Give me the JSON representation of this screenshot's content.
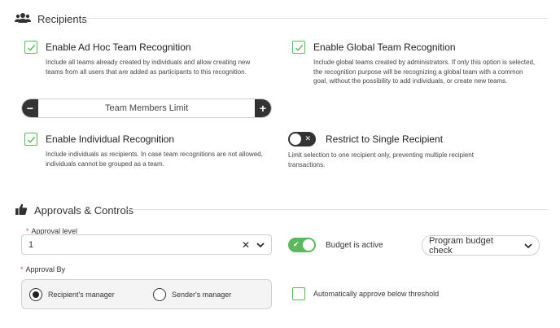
{
  "recipients": {
    "header": "Recipients",
    "icon": "users-icon",
    "options": {
      "adhoc": {
        "title": "Enable Ad Hoc Team Recognition",
        "checked": true,
        "description": "Include all teams already created by individuals and allow creating new teams from all users that are added as participants to this recognition."
      },
      "global": {
        "title": "Enable Global Team Recognition",
        "checked": true,
        "description": "Include global teams created by administrators. If only this option is selected, the recognition purpose will be recognizing a global team with a common goal, without the possibility to add individuals, or create new teams."
      },
      "individual": {
        "title": "Enable Individual Recognition",
        "checked": true,
        "description": "Include individuals as recipients. In case team recognitions are not allowed, individuals cannot be grouped as a team."
      },
      "single": {
        "title": "Restrict to Single Recipient",
        "enabled": false,
        "description": "Limit selection to one recipient only, preventing multiple recipient transactions."
      }
    },
    "stepper": {
      "label": "Team Members Limit",
      "minus": "−",
      "plus": "+"
    }
  },
  "approvals": {
    "header": "Approvals & Controls",
    "icon": "thumbs-up-icon",
    "approval_level": {
      "label": "Approval level",
      "value": "1",
      "clear": "✕",
      "chevron": "⌵"
    },
    "budget": {
      "label": "Budget is active",
      "enabled": true,
      "select_value": "Program budget check"
    },
    "approval_by": {
      "label": "Approval By",
      "options": [
        "Recipient's manager",
        "Sender's manager"
      ],
      "selected": 0
    },
    "auto_approve": {
      "label": "Automatically approve below threshold",
      "checked": false
    }
  },
  "colors": {
    "accent_green": "#5cb85c",
    "dark": "#333333",
    "required_star": "#d9534f"
  }
}
